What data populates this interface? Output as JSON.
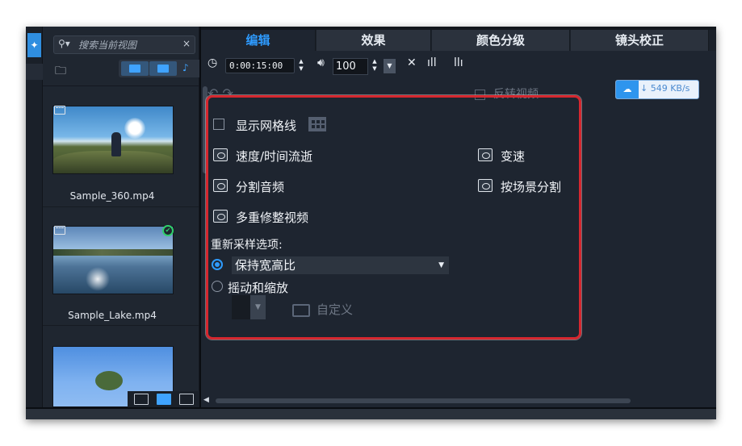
{
  "library": {
    "search_placeholder": "搜索当前视图",
    "clips": [
      {
        "name": "Sample_360.mp4",
        "selected": false
      },
      {
        "name": "Sample_Lake.mp4",
        "selected": true
      },
      {
        "name": "",
        "selected": false
      }
    ]
  },
  "tabs": [
    "编辑",
    "效果",
    "颜色分级",
    "镜头校正"
  ],
  "active_tab": "编辑",
  "toolbar": {
    "timecode": "0:00:15:00",
    "volume": "100"
  },
  "reverse_video_label": "反转视频",
  "speed_badge": "549 KB/s",
  "edit_panel": {
    "show_grid_label": "显示网格线",
    "speed_time_lapse_label": "速度/时间流逝",
    "variable_speed_label": "变速",
    "split_audio_label": "分割音频",
    "split_by_scene_label": "按场景分割",
    "multi_trim_label": "多重修整视频",
    "resample_label": "重新采样选项:",
    "keep_aspect_label": "保持宽高比",
    "pan_zoom_label": "摇动和缩放",
    "custom_label": "自定义"
  },
  "colors": {
    "accent": "#2e9bff",
    "highlight_border": "#d6272f",
    "panel_bg": "#1e2530"
  }
}
